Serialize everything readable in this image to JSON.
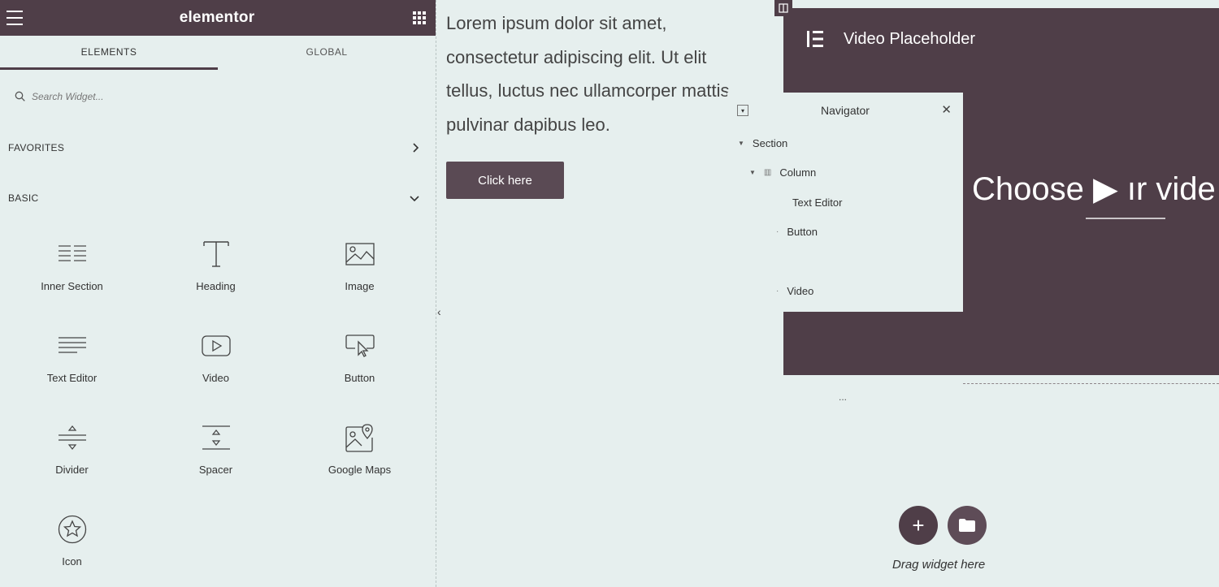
{
  "app": {
    "brand": "elementor"
  },
  "tabs": [
    {
      "label": "ELEMENTS"
    },
    {
      "label": "GLOBAL"
    }
  ],
  "search": {
    "placeholder": "Search Widget..."
  },
  "sections": {
    "favorites": "FAVORITES",
    "basic": "BASIC"
  },
  "widgets": [
    {
      "label": "Inner Section",
      "icon": "inner-section-icon"
    },
    {
      "label": "Heading",
      "icon": "heading-icon"
    },
    {
      "label": "Image",
      "icon": "image-icon"
    },
    {
      "label": "Text Editor",
      "icon": "text-editor-icon"
    },
    {
      "label": "Video",
      "icon": "video-icon"
    },
    {
      "label": "Button",
      "icon": "button-icon"
    },
    {
      "label": "Divider",
      "icon": "divider-icon"
    },
    {
      "label": "Spacer",
      "icon": "spacer-icon"
    },
    {
      "label": "Google Maps",
      "icon": "google-maps-icon"
    },
    {
      "label": "Icon",
      "icon": "star-icon"
    }
  ],
  "canvas": {
    "text": "Lorem ipsum dolor sit amet, consectetur adipiscing elit. Ut elit tellus, luctus nec ullamcorper mattis, pulvinar dapibus leo.",
    "button_label": "Click here",
    "video_title": "Video Placeholder",
    "video_overlay": "Choose ▶ ır vide",
    "drag_text": "Drag widget here",
    "ellipsis": "..."
  },
  "navigator": {
    "title": "Navigator",
    "items": [
      {
        "label": "Section"
      },
      {
        "label": "Column"
      },
      {
        "label": "Text Editor"
      },
      {
        "label": "Button"
      },
      {
        "label": "Video"
      }
    ]
  },
  "colors": {
    "brand": "#4f3e48",
    "panel_bg": "#e6efee"
  }
}
